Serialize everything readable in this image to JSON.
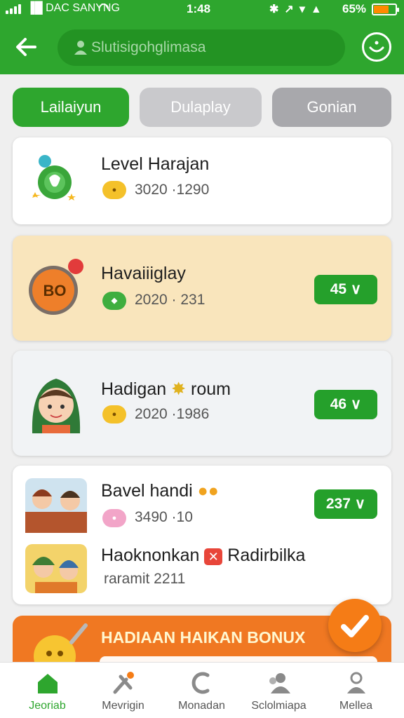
{
  "status_bar": {
    "carrier": "▐█ DAC SANYNG",
    "time": "1:48",
    "battery": "65%",
    "battery_level": 0.65
  },
  "header": {
    "search_placeholder": "Slutisigohglimasa"
  },
  "tabs": [
    {
      "label": "Lailaiyun",
      "active": true
    },
    {
      "label": "Dulaplay",
      "active": false
    },
    {
      "label": "Gonian",
      "active": false
    }
  ],
  "cards": [
    {
      "title": "Level Harajan",
      "subtitle": "3020 ·1290"
    },
    {
      "title": "Havaiiiglay",
      "subtitle": "2020 · 231",
      "badge": "45",
      "avatar_text": "BO"
    },
    {
      "title": "Hadigan",
      "title_suffix": "roum",
      "subtitle": "2020 ·1986",
      "badge": "46"
    },
    {
      "title": "Bavel handi",
      "subtitle": "3490 ·10",
      "badge": "237",
      "second_title": "Haoknonkan",
      "second_title_suffix": "Radirbilka",
      "second_subtitle": "raramit 2211"
    }
  ],
  "banner": {
    "text": "HADIAAN HAIKAN BONUX"
  },
  "bottom_nav": [
    {
      "label": "Jeoriab",
      "icon": "home-icon",
      "active": true
    },
    {
      "label": "Mevrigin",
      "icon": "tools-icon",
      "active": false
    },
    {
      "label": "Monadan",
      "icon": "phone-icon",
      "active": false
    },
    {
      "label": "Sclolmiapa",
      "icon": "people-icon",
      "active": false
    },
    {
      "label": "Mellea",
      "icon": "profile-icon",
      "active": false
    }
  ],
  "colors": {
    "brand_green": "#2ea62e",
    "accent_orange": "#f57c16"
  }
}
